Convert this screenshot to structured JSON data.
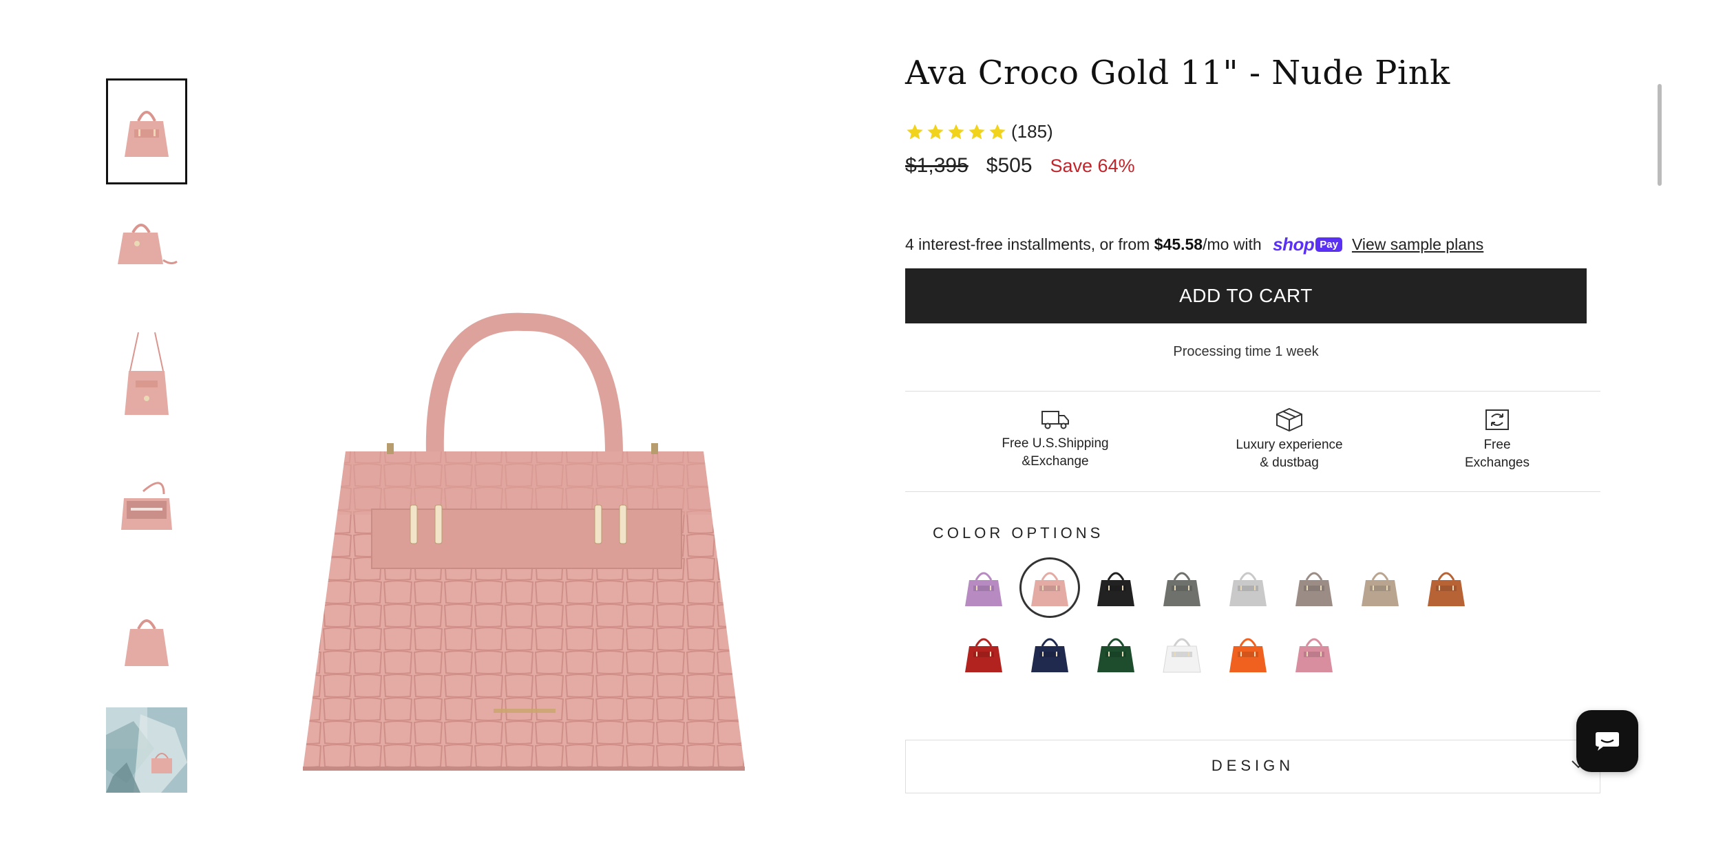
{
  "product": {
    "title": "Ava Croco Gold 11\" - Nude Pink",
    "rating_count": "(185)",
    "rating_value": 5,
    "price_original": "$1,395",
    "price_sale": "$505",
    "save_text": "Save 64%"
  },
  "installments": {
    "prefix": "4 interest-free installments, or from ",
    "amount": "$45.58",
    "suffix": "/mo with ",
    "shop_logo": "shop",
    "pay_badge": "Pay",
    "link": "View sample plans"
  },
  "cart": {
    "button_label": "ADD TO CART",
    "processing": "Processing time 1 week"
  },
  "features": [
    {
      "icon": "delivery-truck-icon",
      "line1": "Free U.S.Shipping",
      "line2": "&Exchange"
    },
    {
      "icon": "gift-box-icon",
      "line1": "Luxury experience",
      "line2": "& dustbag"
    },
    {
      "icon": "exchange-box-icon",
      "line1": "Free",
      "line2": "Exchanges"
    }
  ],
  "color_options": {
    "title": "COLOR OPTIONS",
    "selected_index": 1,
    "swatches": [
      {
        "color": "#b78ac2"
      },
      {
        "color": "#e3aba4"
      },
      {
        "color": "#222222"
      },
      {
        "color": "#6e716c"
      },
      {
        "color": "#c9c9c9"
      },
      {
        "color": "#9b8d86"
      },
      {
        "color": "#b8a48f"
      },
      {
        "color": "#b76336"
      },
      {
        "color": "#b2231f"
      },
      {
        "color": "#1f2a4e"
      },
      {
        "color": "#1d4d2c"
      },
      {
        "color": "#f2f2f2"
      },
      {
        "color": "#f0611f"
      },
      {
        "color": "#d88e9f"
      }
    ]
  },
  "accordion": {
    "design_label": "DESIGN"
  },
  "colors": {
    "accent_sale": "#c0252b",
    "shop_purple": "#5a31f4",
    "button_dark": "#222222",
    "star_yellow": "#f2d31b",
    "bag_pink": "#e3aba4"
  }
}
